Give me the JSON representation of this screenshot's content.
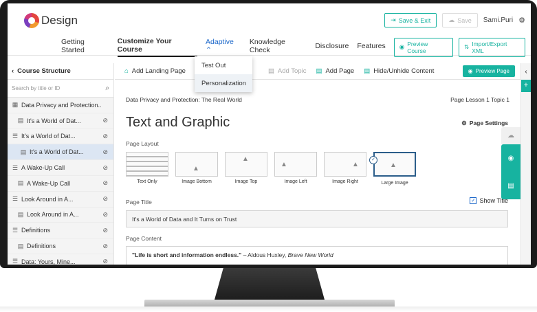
{
  "app": {
    "logo_text": "Design"
  },
  "header": {
    "save_exit": "Save & Exit",
    "save": "Save",
    "user": "Sami.Puri"
  },
  "nav": {
    "tabs": [
      "Getting Started",
      "Customize Your Course",
      "Adaptive",
      "Knowledge Check",
      "Disclosure",
      "Features"
    ],
    "preview_course": "Preview Course",
    "import_export": "Import/Export XML"
  },
  "adaptive_menu": {
    "items": [
      "Test Out",
      "Personalization"
    ]
  },
  "sidebar": {
    "title": "Course Structure",
    "search_placeholder": "Search by title or ID",
    "items": [
      {
        "label": "Data Privacy and Protection..",
        "icon": "grid-icon"
      },
      {
        "label": "It's a World of Dat...",
        "icon": "page-icon"
      },
      {
        "label": "It's a World of Dat...",
        "icon": "list-icon"
      },
      {
        "label": "It's a World of Dat...",
        "icon": "page-icon"
      },
      {
        "label": "A Wake-Up Call",
        "icon": "list-icon"
      },
      {
        "label": "A Wake-Up Call",
        "icon": "page-icon"
      },
      {
        "label": "Look Around in A...",
        "icon": "list-icon"
      },
      {
        "label": "Look Around in A...",
        "icon": "page-icon"
      },
      {
        "label": "Definitions",
        "icon": "list-icon"
      },
      {
        "label": "Definitions",
        "icon": "page-icon"
      },
      {
        "label": "Data: Yours, Mine...",
        "icon": "list-icon"
      }
    ]
  },
  "toolbar": {
    "add_landing": "Add Landing Page",
    "add_topic": "Add Topic",
    "add_page": "Add Page",
    "hide_unhide": "Hide/Unhide Content",
    "preview_page": "Preview Page"
  },
  "content": {
    "breadcrumb": "Data Privacy and Protection: The Real World",
    "page_ref": "Page Lesson 1 Topic 1",
    "title": "Text and Graphic",
    "page_settings": "Page Settings",
    "layout_label": "Page Layout",
    "layouts": [
      "Text Only",
      "Image Bottom",
      "Image Top",
      "Image Left",
      "Image Right",
      "Large Image"
    ],
    "page_title_label": "Page Title",
    "show_title": "Show Title",
    "page_title_value": "It's a World of Data and It Turns on Trust",
    "page_content_label": "Page Content",
    "quote": "\"Life is short and information endless.\"",
    "quote_attr": " – Aldous Huxley, ",
    "quote_book": "Brave New World"
  },
  "colors": {
    "accent": "#17b3a0",
    "link": "#1a66c9",
    "selected_bg": "#dce6f3"
  }
}
